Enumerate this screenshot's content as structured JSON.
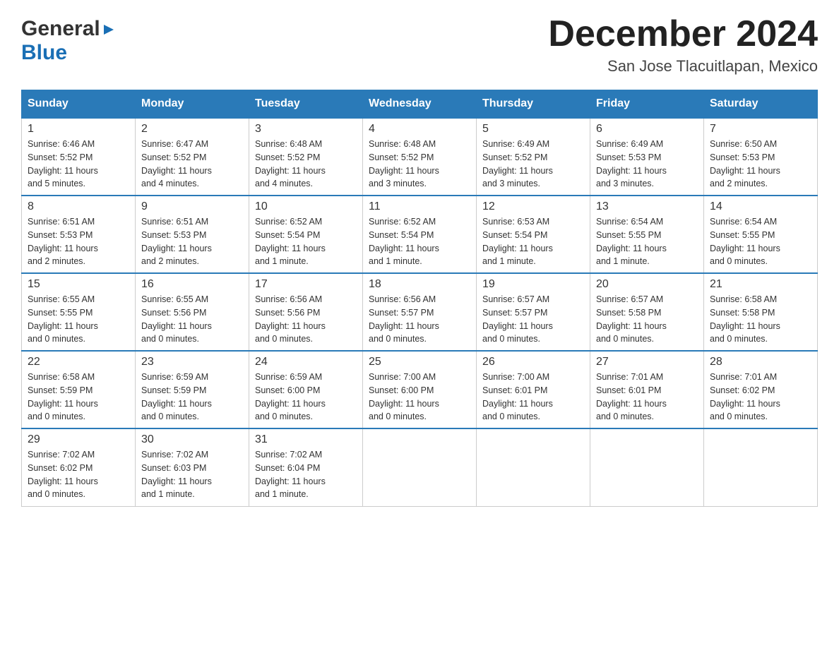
{
  "header": {
    "logo_general": "General",
    "logo_blue": "Blue",
    "month_title": "December 2024",
    "location": "San Jose Tlacuitlapan, Mexico"
  },
  "days_of_week": [
    "Sunday",
    "Monday",
    "Tuesday",
    "Wednesday",
    "Thursday",
    "Friday",
    "Saturday"
  ],
  "weeks": [
    [
      {
        "day": "1",
        "sunrise": "6:46 AM",
        "sunset": "5:52 PM",
        "daylight": "11 hours and 5 minutes."
      },
      {
        "day": "2",
        "sunrise": "6:47 AM",
        "sunset": "5:52 PM",
        "daylight": "11 hours and 4 minutes."
      },
      {
        "day": "3",
        "sunrise": "6:48 AM",
        "sunset": "5:52 PM",
        "daylight": "11 hours and 4 minutes."
      },
      {
        "day": "4",
        "sunrise": "6:48 AM",
        "sunset": "5:52 PM",
        "daylight": "11 hours and 3 minutes."
      },
      {
        "day": "5",
        "sunrise": "6:49 AM",
        "sunset": "5:52 PM",
        "daylight": "11 hours and 3 minutes."
      },
      {
        "day": "6",
        "sunrise": "6:49 AM",
        "sunset": "5:53 PM",
        "daylight": "11 hours and 3 minutes."
      },
      {
        "day": "7",
        "sunrise": "6:50 AM",
        "sunset": "5:53 PM",
        "daylight": "11 hours and 2 minutes."
      }
    ],
    [
      {
        "day": "8",
        "sunrise": "6:51 AM",
        "sunset": "5:53 PM",
        "daylight": "11 hours and 2 minutes."
      },
      {
        "day": "9",
        "sunrise": "6:51 AM",
        "sunset": "5:53 PM",
        "daylight": "11 hours and 2 minutes."
      },
      {
        "day": "10",
        "sunrise": "6:52 AM",
        "sunset": "5:54 PM",
        "daylight": "11 hours and 1 minute."
      },
      {
        "day": "11",
        "sunrise": "6:52 AM",
        "sunset": "5:54 PM",
        "daylight": "11 hours and 1 minute."
      },
      {
        "day": "12",
        "sunrise": "6:53 AM",
        "sunset": "5:54 PM",
        "daylight": "11 hours and 1 minute."
      },
      {
        "day": "13",
        "sunrise": "6:54 AM",
        "sunset": "5:55 PM",
        "daylight": "11 hours and 1 minute."
      },
      {
        "day": "14",
        "sunrise": "6:54 AM",
        "sunset": "5:55 PM",
        "daylight": "11 hours and 0 minutes."
      }
    ],
    [
      {
        "day": "15",
        "sunrise": "6:55 AM",
        "sunset": "5:55 PM",
        "daylight": "11 hours and 0 minutes."
      },
      {
        "day": "16",
        "sunrise": "6:55 AM",
        "sunset": "5:56 PM",
        "daylight": "11 hours and 0 minutes."
      },
      {
        "day": "17",
        "sunrise": "6:56 AM",
        "sunset": "5:56 PM",
        "daylight": "11 hours and 0 minutes."
      },
      {
        "day": "18",
        "sunrise": "6:56 AM",
        "sunset": "5:57 PM",
        "daylight": "11 hours and 0 minutes."
      },
      {
        "day": "19",
        "sunrise": "6:57 AM",
        "sunset": "5:57 PM",
        "daylight": "11 hours and 0 minutes."
      },
      {
        "day": "20",
        "sunrise": "6:57 AM",
        "sunset": "5:58 PM",
        "daylight": "11 hours and 0 minutes."
      },
      {
        "day": "21",
        "sunrise": "6:58 AM",
        "sunset": "5:58 PM",
        "daylight": "11 hours and 0 minutes."
      }
    ],
    [
      {
        "day": "22",
        "sunrise": "6:58 AM",
        "sunset": "5:59 PM",
        "daylight": "11 hours and 0 minutes."
      },
      {
        "day": "23",
        "sunrise": "6:59 AM",
        "sunset": "5:59 PM",
        "daylight": "11 hours and 0 minutes."
      },
      {
        "day": "24",
        "sunrise": "6:59 AM",
        "sunset": "6:00 PM",
        "daylight": "11 hours and 0 minutes."
      },
      {
        "day": "25",
        "sunrise": "7:00 AM",
        "sunset": "6:00 PM",
        "daylight": "11 hours and 0 minutes."
      },
      {
        "day": "26",
        "sunrise": "7:00 AM",
        "sunset": "6:01 PM",
        "daylight": "11 hours and 0 minutes."
      },
      {
        "day": "27",
        "sunrise": "7:01 AM",
        "sunset": "6:01 PM",
        "daylight": "11 hours and 0 minutes."
      },
      {
        "day": "28",
        "sunrise": "7:01 AM",
        "sunset": "6:02 PM",
        "daylight": "11 hours and 0 minutes."
      }
    ],
    [
      {
        "day": "29",
        "sunrise": "7:02 AM",
        "sunset": "6:02 PM",
        "daylight": "11 hours and 0 minutes."
      },
      {
        "day": "30",
        "sunrise": "7:02 AM",
        "sunset": "6:03 PM",
        "daylight": "11 hours and 1 minute."
      },
      {
        "day": "31",
        "sunrise": "7:02 AM",
        "sunset": "6:04 PM",
        "daylight": "11 hours and 1 minute."
      },
      null,
      null,
      null,
      null
    ]
  ],
  "labels": {
    "sunrise": "Sunrise:",
    "sunset": "Sunset:",
    "daylight": "Daylight:"
  }
}
